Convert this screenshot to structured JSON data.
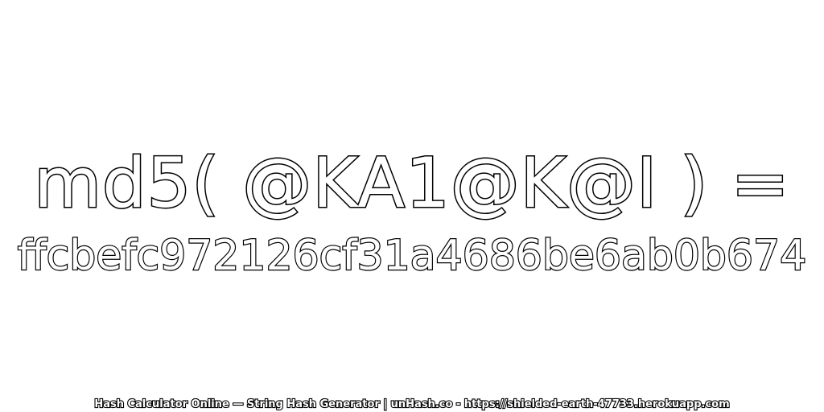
{
  "headline": "md5( @KA1@K@I ) =",
  "hash": "ffcbefc972126cf31a4686be6ab0b674",
  "footer": "Hash Calculator Online — String Hash Generator | unHash.co - https://shielded-earth-47733.herokuapp.com",
  "colors": {
    "background": "#ffffff",
    "text_fill": "#ffffff",
    "text_outline": "#000000"
  }
}
